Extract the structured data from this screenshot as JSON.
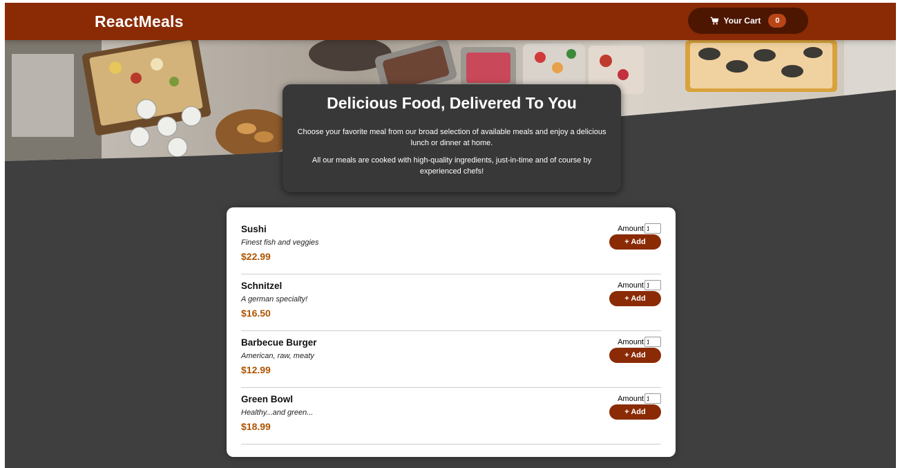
{
  "header": {
    "brand": "ReactMeals",
    "cart_label": "Your Cart",
    "cart_count": "0"
  },
  "summary": {
    "title": "Delicious Food, Delivered To You",
    "paragraph1": "Choose your favorite meal from our broad selection of available meals and enjoy a delicious lunch or dinner at home.",
    "paragraph2": "All our meals are cooked with high-quality ingredients, just-in-time and of course by experienced chefs!"
  },
  "meals": [
    {
      "name": "Sushi",
      "description": "Finest fish and veggies",
      "price": "$22.99",
      "amount_label": "Amount",
      "amount": "1",
      "add_label": "+ Add"
    },
    {
      "name": "Schnitzel",
      "description": "A german specialty!",
      "price": "$16.50",
      "amount_label": "Amount",
      "amount": "1",
      "add_label": "+ Add"
    },
    {
      "name": "Barbecue Burger",
      "description": "American, raw, meaty",
      "price": "$12.99",
      "amount_label": "Amount",
      "amount": "1",
      "add_label": "+ Add"
    },
    {
      "name": "Green Bowl",
      "description": "Healthy...and green...",
      "price": "$18.99",
      "amount_label": "Amount",
      "amount": "1",
      "add_label": "+ Add"
    }
  ],
  "colors": {
    "header_bg": "#8a2b06",
    "cart_button_bg": "#4d1601",
    "cart_badge_bg": "#b94517",
    "page_bg": "#3f3f3f",
    "price": "#ad5502"
  },
  "icons": {
    "cart": "cart-icon"
  }
}
